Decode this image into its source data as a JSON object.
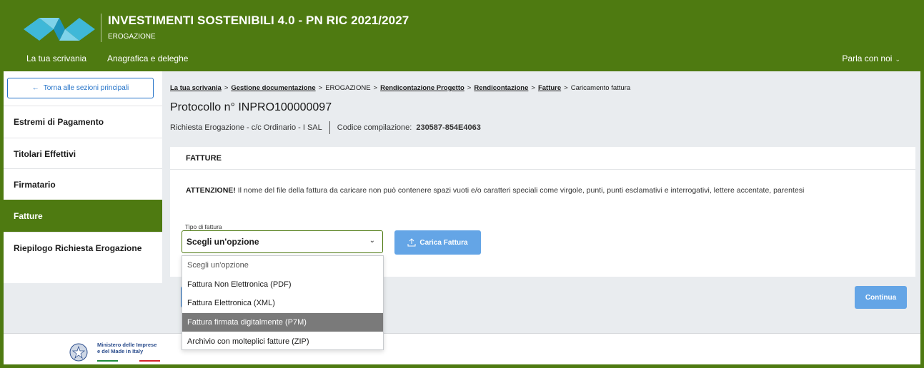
{
  "header": {
    "title": "INVESTIMENTI SOSTENIBILI 4.0 - PN RIC 2021/2027",
    "subtitle": "EROGAZIONE",
    "nav": [
      "La tua scrivania",
      "Anagrafica e deleghe"
    ],
    "talk_label": "Parla con noi"
  },
  "sidebar": {
    "back_label": "Torna alle sezioni principali",
    "items": [
      {
        "label": "Estremi di Pagamento"
      },
      {
        "label": "Titolari Effettivi"
      },
      {
        "label": "Firmatario"
      },
      {
        "label": "Fatture"
      },
      {
        "label": "Riepilogo Richiesta Erogazione"
      }
    ],
    "active_item": "Fatture"
  },
  "breadcrumb": {
    "items": [
      "La tua scrivania",
      "Gestione documentazione",
      "EROGAZIONE",
      "Rendicontazione Progetto",
      "Rendicontazione",
      "Fatture",
      "Caricamento fattura"
    ],
    "separator": ">"
  },
  "main": {
    "protocol": "Protocollo n° INPRO100000097",
    "meta_left": "Richiesta Erogazione - c/c Ordinario -  I SAL",
    "meta_code_label": "Codice compilazione:",
    "meta_code_value": "230587-854E4063",
    "panel_title": "FATTURE",
    "warning_bold": "ATTENZIONE!",
    "warning_text": " Il nome del file della fattura da caricare non può contenere spazi vuoti e/o caratteri speciali come virgole, punti, punti esclamativi e interrogativi, lettere accentate, parentesi",
    "field_label": "Tipo di fattura",
    "select_value": "Scegli un'opzione",
    "upload_label": "Carica Fattura",
    "continue_label": "Continua",
    "options": [
      "Scegli un'opzione",
      "Fattura Non Elettronica (PDF)",
      "Fattura Elettronica (XML)",
      "Fattura firmata digitalmente (P7M)",
      "Archivio con molteplici fatture (ZIP)"
    ],
    "highlighted_option": "Fattura firmata digitalmente (P7M)"
  },
  "footer": {
    "ministry_line1": "Ministero delle Imprese",
    "ministry_line2": "e del Made in Italy"
  },
  "colors": {
    "brand_green": "#4e7a11",
    "link_blue": "#2372c8",
    "button_blue": "#64a5e6",
    "highlight_gray": "#7a7a7a"
  }
}
